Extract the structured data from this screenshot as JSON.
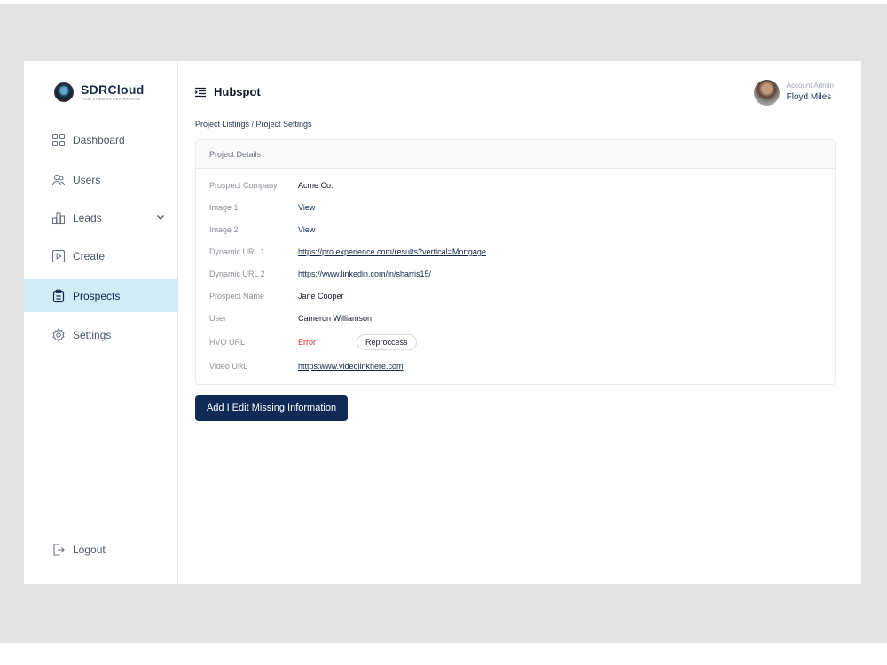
{
  "brand": {
    "name": "SDRCloud",
    "tagline": "YOUR AI MARKETING MACHINE"
  },
  "sidebar": {
    "items": [
      {
        "label": "Dashboard",
        "icon": "dashboard-icon"
      },
      {
        "label": "Users",
        "icon": "users-icon"
      },
      {
        "label": "Leads",
        "icon": "leads-icon"
      },
      {
        "label": "Create",
        "icon": "play-square-icon"
      },
      {
        "label": "Prospects",
        "icon": "clipboard-icon",
        "active": true
      },
      {
        "label": "Settings",
        "icon": "gear-icon"
      }
    ],
    "logout_label": "Logout"
  },
  "header": {
    "title": "Hubspot",
    "icon": "menu-icon"
  },
  "account": {
    "role": "Account Admin",
    "name": "Floyd Miles"
  },
  "breadcrumb": "Project Listings / Project Settings",
  "project_details": {
    "heading": "Project Details",
    "rows": [
      {
        "label": "Prospect Company",
        "value": "Acme Co."
      },
      {
        "label": "Image 1",
        "value": "View"
      },
      {
        "label": "Image 2",
        "value": "View"
      },
      {
        "label": "Dynamic URL 1",
        "value": "https://pro.experience.com/results?vertical=Mortgage"
      },
      {
        "label": "Dynamic URL 2",
        "value": "https://www.linkedin.com/in/sharris15/"
      },
      {
        "label": "Prospect Name",
        "value": "Jane Cooper"
      },
      {
        "label": "User",
        "value": "Cameron Williamson"
      },
      {
        "label": "HVO URL",
        "value": "Error",
        "action": "Reproccess"
      },
      {
        "label": "Video URL",
        "value": "htttps:www.videolinkhere.com"
      }
    ]
  },
  "actions": {
    "primary_label": "Add I Edit Missing Information"
  },
  "colors": {
    "accent": "#0f2a55",
    "active_bg": "#d3ebf6",
    "error": "#e02424",
    "backdrop": "#e3e3e3"
  }
}
